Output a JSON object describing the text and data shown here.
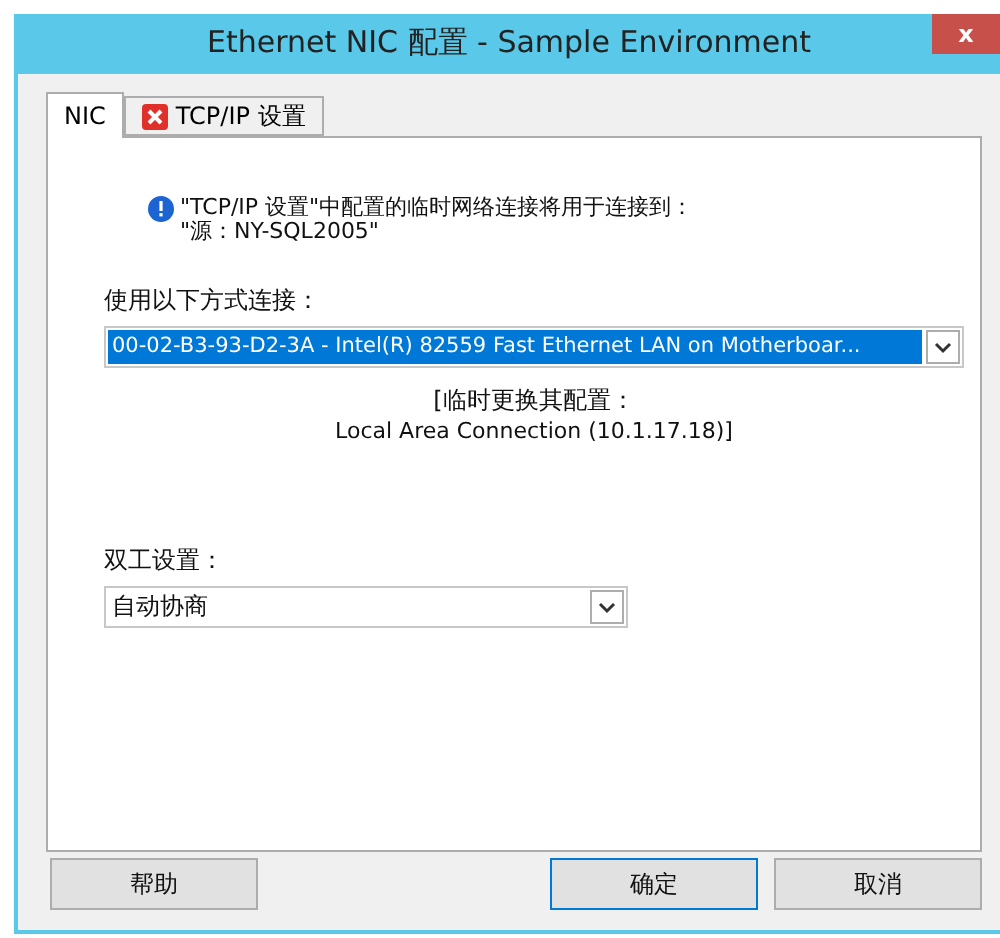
{
  "window": {
    "title": "Ethernet NIC 配置 - Sample Environment",
    "close": "x"
  },
  "tabs": [
    {
      "label": "NIC",
      "selected": true,
      "error": false
    },
    {
      "label": "TCP/IP 设置",
      "selected": false,
      "error": true
    }
  ],
  "info": {
    "lines": [
      "\"TCP/IP 设置\"中配置的临时网络连接将用于连接到：",
      "\"源：NY-SQL2005\""
    ]
  },
  "connection": {
    "label": "使用以下方式连接：",
    "value": "00-02-B3-93-D2-3A - Intel(R) 82559 Fast Ethernet LAN on Motherboar...",
    "highlighted": true
  },
  "replace_note": {
    "lines": [
      "[临时更换其配置：",
      "Local Area Connection (10.1.17.18)]"
    ]
  },
  "duplex": {
    "label": "双工设置：",
    "value": "自动协商",
    "highlighted": false
  },
  "buttons": [
    {
      "label": "帮助",
      "default": false
    },
    {
      "label": "确定",
      "default": true
    },
    {
      "label": "取消",
      "default": false
    }
  ]
}
